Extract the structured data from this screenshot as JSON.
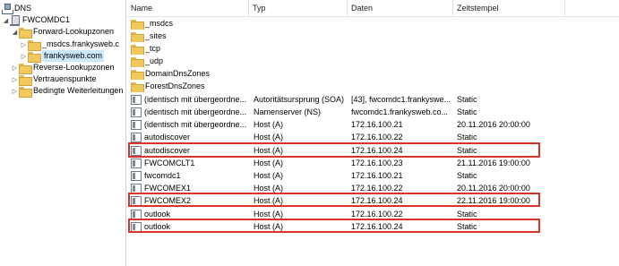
{
  "tree": {
    "root": "DNS",
    "server": "FWCOMDC1",
    "forward_zones": "Forward-Lookupzonen",
    "msdcs_zone": "_msdcs.frankysweb.c",
    "zone": "frankysweb.com",
    "reverse_zones": "Reverse-Lookupzonen",
    "trust_points": "Vertrauenspunkte",
    "conditional_forwarders": "Bedingte Weiterleitungen"
  },
  "columns": {
    "name": "Name",
    "type": "Typ",
    "data": "Daten",
    "timestamp": "Zeitstempel"
  },
  "rows": [
    {
      "name": "_msdcs",
      "type": "",
      "data": "",
      "timestamp": "",
      "icon": "folder-icon"
    },
    {
      "name": "_sites",
      "type": "",
      "data": "",
      "timestamp": "",
      "icon": "folder-icon"
    },
    {
      "name": "_tcp",
      "type": "",
      "data": "",
      "timestamp": "",
      "icon": "folder-icon"
    },
    {
      "name": "_udp",
      "type": "",
      "data": "",
      "timestamp": "",
      "icon": "folder-icon"
    },
    {
      "name": "DomainDnsZones",
      "type": "",
      "data": "",
      "timestamp": "",
      "icon": "folder-icon"
    },
    {
      "name": "ForestDnsZones",
      "type": "",
      "data": "",
      "timestamp": "",
      "icon": "folder-icon"
    },
    {
      "name": "(identisch mit übergeordne...",
      "type": "Autoritätsursprung (SOA)",
      "data": "[43], fwcomdc1.frankyswe...",
      "timestamp": "Static",
      "icon": "record-icon"
    },
    {
      "name": "(identisch mit übergeordne...",
      "type": "Namenserver (NS)",
      "data": "fwcomdc1.frankysweb.co...",
      "timestamp": "Static",
      "icon": "record-icon"
    },
    {
      "name": "(identisch mit übergeordne...",
      "type": "Host (A)",
      "data": "172.16.100.21",
      "timestamp": "20.11.2016 20:00:00",
      "icon": "record-icon"
    },
    {
      "name": "autodiscover",
      "type": "Host (A)",
      "data": "172.16.100.22",
      "timestamp": "Static",
      "icon": "record-icon"
    },
    {
      "name": "autodiscover",
      "type": "Host (A)",
      "data": "172.16.100.24",
      "timestamp": "Static",
      "icon": "record-icon"
    },
    {
      "name": "FWCOMCLT1",
      "type": "Host (A)",
      "data": "172.16.100.23",
      "timestamp": "21.11.2016 19:00:00",
      "icon": "record-icon"
    },
    {
      "name": "fwcomdc1",
      "type": "Host (A)",
      "data": "172.16.100.21",
      "timestamp": "Static",
      "icon": "record-icon"
    },
    {
      "name": "FWCOMEX1",
      "type": "Host (A)",
      "data": "172.16.100.22",
      "timestamp": "20.11.2016 20:00:00",
      "icon": "record-icon"
    },
    {
      "name": "FWCOMEX2",
      "type": "Host (A)",
      "data": "172.16.100.24",
      "timestamp": "22.11.2016 19:00:00",
      "icon": "record-icon"
    },
    {
      "name": "outlook",
      "type": "Host (A)",
      "data": "172.16.100.22",
      "timestamp": "Static",
      "icon": "record-icon"
    },
    {
      "name": "outlook",
      "type": "Host (A)",
      "data": "172.16.100.24",
      "timestamp": "Static",
      "icon": "record-icon"
    }
  ],
  "highlight_color": "#d9342b",
  "selection_color": "#cce8ff"
}
